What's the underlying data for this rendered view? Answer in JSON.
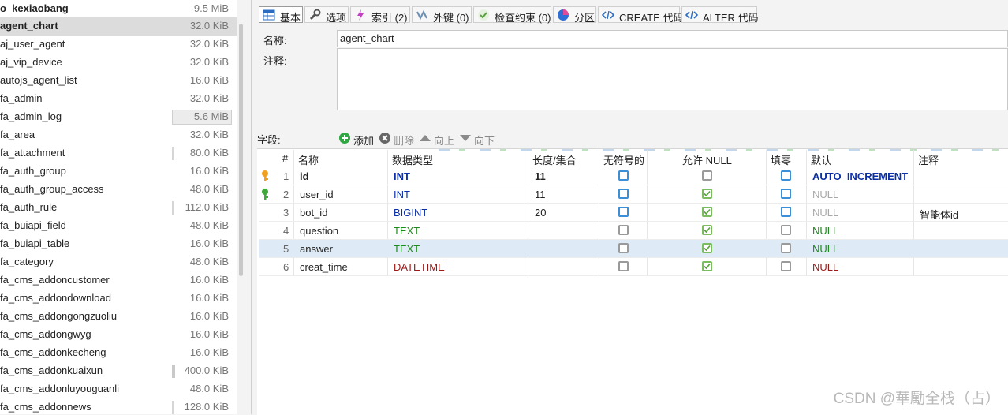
{
  "tables": [
    {
      "name": "o_kexiaobang",
      "size": "9.5 MiB"
    },
    {
      "name": "agent_chart",
      "size": "32.0 KiB"
    },
    {
      "name": "aj_user_agent",
      "size": "32.0 KiB"
    },
    {
      "name": "aj_vip_device",
      "size": "32.0 KiB"
    },
    {
      "name": "autojs_agent_list",
      "size": "16.0 KiB"
    },
    {
      "name": "fa_admin",
      "size": "32.0 KiB"
    },
    {
      "name": "fa_admin_log",
      "size": "5.6 MiB"
    },
    {
      "name": "fa_area",
      "size": "32.0 KiB"
    },
    {
      "name": "fa_attachment",
      "size": "80.0 KiB"
    },
    {
      "name": "fa_auth_group",
      "size": "16.0 KiB"
    },
    {
      "name": "fa_auth_group_access",
      "size": "48.0 KiB"
    },
    {
      "name": "fa_auth_rule",
      "size": "112.0 KiB"
    },
    {
      "name": "fa_buiapi_field",
      "size": "48.0 KiB"
    },
    {
      "name": "fa_buiapi_table",
      "size": "16.0 KiB"
    },
    {
      "name": "fa_category",
      "size": "48.0 KiB"
    },
    {
      "name": "fa_cms_addoncustomer",
      "size": "16.0 KiB"
    },
    {
      "name": "fa_cms_addondownload",
      "size": "16.0 KiB"
    },
    {
      "name": "fa_cms_addongongzuoliu",
      "size": "16.0 KiB"
    },
    {
      "name": "fa_cms_addongwyg",
      "size": "16.0 KiB"
    },
    {
      "name": "fa_cms_addonkecheng",
      "size": "16.0 KiB"
    },
    {
      "name": "fa_cms_addonkuaixun",
      "size": "400.0 KiB"
    },
    {
      "name": "fa_cms_addonluyouguanli",
      "size": "48.0 KiB"
    },
    {
      "name": "fa_cms_addonnews",
      "size": "128.0 KiB"
    }
  ],
  "tabs": [
    {
      "label": "基本",
      "icon": "grid-icon"
    },
    {
      "label": "选项",
      "icon": "wrench-icon"
    },
    {
      "label": "索引 (2)",
      "icon": "lightning-icon"
    },
    {
      "label": "外键 (0)",
      "icon": "foreign-key-icon"
    },
    {
      "label": "检查约束 (0)",
      "icon": "check-circle-icon"
    },
    {
      "label": "分区",
      "icon": "pie-icon"
    },
    {
      "label": "CREATE 代码",
      "icon": "code-icon"
    },
    {
      "label": "ALTER 代码",
      "icon": "code-icon"
    }
  ],
  "form": {
    "name_label": "名称:",
    "name_value": "agent_chart",
    "comment_label": "注释:",
    "comment_value": ""
  },
  "fields_toolbar": {
    "label": "字段:",
    "add": "添加",
    "delete": "删除",
    "up": "向上",
    "down": "向下"
  },
  "columns_header": [
    "#",
    "名称",
    "数据类型",
    "长度/集合",
    "无符号的",
    "允许 NULL",
    "填零",
    "默认",
    "注释"
  ],
  "columns": [
    {
      "num": "1",
      "name": "id",
      "type": "INT",
      "length": "11",
      "unsigned": false,
      "nullable": false,
      "zerofill": false,
      "default": "AUTO_INCREMENT",
      "comment": "",
      "key": "primary"
    },
    {
      "num": "2",
      "name": "user_id",
      "type": "INT",
      "length": "11",
      "unsigned": false,
      "nullable": true,
      "zerofill": false,
      "default": "NULL",
      "comment": "",
      "key": "index"
    },
    {
      "num": "3",
      "name": "bot_id",
      "type": "BIGINT",
      "length": "20",
      "unsigned": false,
      "nullable": true,
      "zerofill": false,
      "default": "NULL",
      "comment": "智能体id",
      "key": ""
    },
    {
      "num": "4",
      "name": "question",
      "type": "TEXT",
      "length": "",
      "unsigned": false,
      "nullable": true,
      "zerofill": false,
      "default": "NULL",
      "comment": "",
      "key": ""
    },
    {
      "num": "5",
      "name": "answer",
      "type": "TEXT",
      "length": "",
      "unsigned": false,
      "nullable": true,
      "zerofill": false,
      "default": "NULL",
      "comment": "",
      "key": ""
    },
    {
      "num": "6",
      "name": "creat_time",
      "type": "DATETIME",
      "length": "",
      "unsigned": false,
      "nullable": true,
      "zerofill": false,
      "default": "NULL",
      "comment": "",
      "key": ""
    }
  ],
  "watermark": "CSDN @華勵全栈（占）",
  "colors": {
    "accent": "#0a2fa8",
    "text_type": "#1d8a1d",
    "datetime_type": "#9a1a1a",
    "selected_row": "#deebf7"
  }
}
